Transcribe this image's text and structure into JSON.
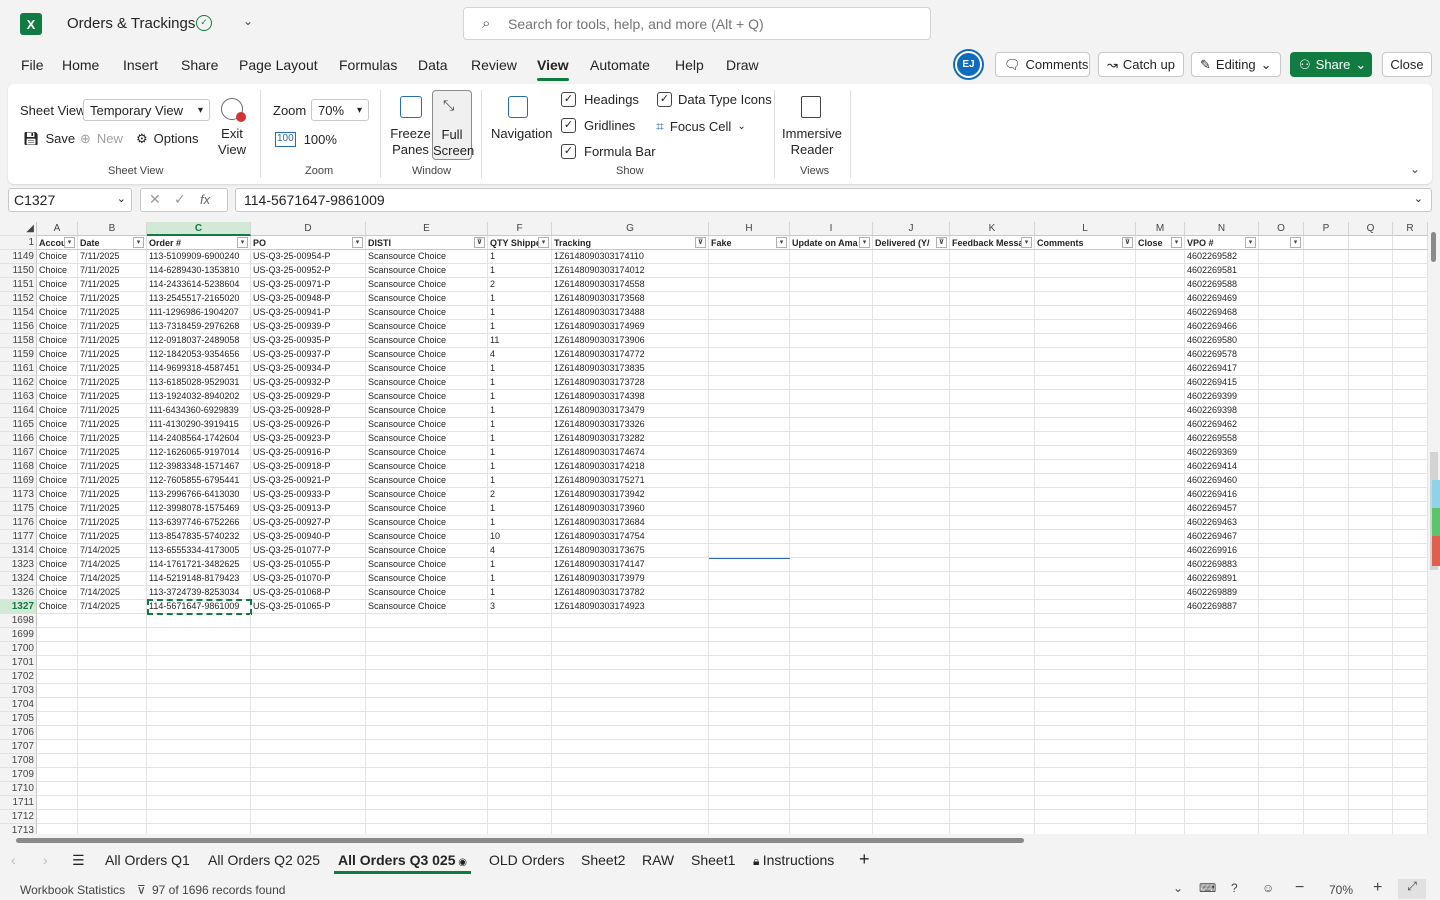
{
  "app": {
    "title": "Orders & Trackings",
    "search_placeholder": "Search for tools, help, and more (Alt + Q)"
  },
  "menu": [
    "File",
    "Home",
    "Insert",
    "Share",
    "Page Layout",
    "Formulas",
    "Data",
    "Review",
    "View",
    "Automate",
    "Help",
    "Draw"
  ],
  "active_menu": "View",
  "header_buttons": {
    "avatar": "EJ",
    "comments": "Comments",
    "catchup": "Catch up",
    "editing": "Editing",
    "share": "Share",
    "close": "Close"
  },
  "ribbon": {
    "sheet_view_label": "Sheet View",
    "sheet_view_value": "Temporary View",
    "save": "Save",
    "new": "New",
    "options": "Options",
    "exit_view": "Exit View",
    "sheet_view_group": "Sheet View",
    "zoom_label": "Zoom",
    "zoom_value": "70%",
    "zoom_100": "100%",
    "zoom_group": "Zoom",
    "freeze_panes": "Freeze Panes",
    "full_screen": "Full Screen",
    "window_group": "Window",
    "navigation": "Navigation",
    "headings": "Headings",
    "gridlines": "Gridlines",
    "formula_bar": "Formula Bar",
    "data_type_icons": "Data Type Icons",
    "focus_cell": "Focus Cell",
    "show_group": "Show",
    "immersive_reader": "Immersive Reader",
    "views_group": "Views"
  },
  "formula_bar": {
    "name_box": "C1327",
    "fx": "fx",
    "value": "114-5671647-9861009"
  },
  "columns": [
    "A",
    "B",
    "C",
    "D",
    "E",
    "F",
    "G",
    "H",
    "I",
    "J",
    "K",
    "L",
    "M",
    "N",
    "O",
    "P",
    "Q",
    "R"
  ],
  "selected_column": "C",
  "header_row": {
    "row_num": "1",
    "cells": [
      "Accou",
      "Date",
      "Order #",
      "PO",
      "DISTI",
      "QTY Shippe",
      "Tracking",
      "Fake",
      "Update on Ama",
      "Delivered (Y/",
      "Feedback Messa",
      "Comments",
      "Close",
      "VPO #",
      "",
      "",
      "",
      ""
    ]
  },
  "rows": [
    {
      "n": "1149",
      "a": "Choice",
      "b": "7/11/2025",
      "c": "113-5109909-6900240",
      "d": "US-Q3-25-00954-P",
      "e": "Scansource Choice",
      "f": "1",
      "g": "1Z6148090303174110",
      "n2": "4602269582"
    },
    {
      "n": "1150",
      "a": "Choice",
      "b": "7/11/2025",
      "c": "114-6289430-1353810",
      "d": "US-Q3-25-00952-P",
      "e": "Scansource Choice",
      "f": "1",
      "g": "1Z6148090303174012",
      "n2": "4602269581"
    },
    {
      "n": "1151",
      "a": "Choice",
      "b": "7/11/2025",
      "c": "114-2433614-5238604",
      "d": "US-Q3-25-00971-P",
      "e": "Scansource Choice",
      "f": "2",
      "g": "1Z6148090303174558",
      "n2": "4602269588"
    },
    {
      "n": "1152",
      "a": "Choice",
      "b": "7/11/2025",
      "c": "113-2545517-2165020",
      "d": "US-Q3-25-00948-P",
      "e": "Scansource Choice",
      "f": "1",
      "g": "1Z6148090303173568",
      "n2": "4602269469"
    },
    {
      "n": "1154",
      "a": "Choice",
      "b": "7/11/2025",
      "c": "111-1296986-1904207",
      "d": "US-Q3-25-00941-P",
      "e": "Scansource Choice",
      "f": "1",
      "g": "1Z6148090303173488",
      "n2": "4602269468"
    },
    {
      "n": "1156",
      "a": "Choice",
      "b": "7/11/2025",
      "c": "113-7318459-2976268",
      "d": "US-Q3-25-00939-P",
      "e": "Scansource Choice",
      "f": "1",
      "g": "1Z6148090303174969",
      "n2": "4602269466"
    },
    {
      "n": "1158",
      "a": "Choice",
      "b": "7/11/2025",
      "c": "112-0918037-2489058",
      "d": "US-Q3-25-00935-P",
      "e": "Scansource Choice",
      "f": "11",
      "g": "1Z6148090303173906",
      "n2": "4602269580"
    },
    {
      "n": "1159",
      "a": "Choice",
      "b": "7/11/2025",
      "c": "112-1842053-9354656",
      "d": "US-Q3-25-00937-P",
      "e": "Scansource Choice",
      "f": "4",
      "g": "1Z6148090303174772",
      "n2": "4602269578"
    },
    {
      "n": "1161",
      "a": "Choice",
      "b": "7/11/2025",
      "c": "114-9699318-4587451",
      "d": "US-Q3-25-00934-P",
      "e": "Scansource Choice",
      "f": "1",
      "g": "1Z6148090303173835",
      "n2": "4602269417"
    },
    {
      "n": "1162",
      "a": "Choice",
      "b": "7/11/2025",
      "c": "113-6185028-9529031",
      "d": "US-Q3-25-00932-P",
      "e": "Scansource Choice",
      "f": "1",
      "g": "1Z6148090303173728",
      "n2": "4602269415"
    },
    {
      "n": "1163",
      "a": "Choice",
      "b": "7/11/2025",
      "c": "113-1924032-8940202",
      "d": "US-Q3-25-00929-P",
      "e": "Scansource Choice",
      "f": "1",
      "g": "1Z6148090303174398",
      "n2": "4602269399"
    },
    {
      "n": "1164",
      "a": "Choice",
      "b": "7/11/2025",
      "c": "111-6434360-6929839",
      "d": "US-Q3-25-00928-P",
      "e": "Scansource Choice",
      "f": "1",
      "g": "1Z6148090303173479",
      "n2": "4602269398"
    },
    {
      "n": "1165",
      "a": "Choice",
      "b": "7/11/2025",
      "c": "111-4130290-3919415",
      "d": "US-Q3-25-00926-P",
      "e": "Scansource Choice",
      "f": "1",
      "g": "1Z6148090303173326",
      "n2": "4602269462"
    },
    {
      "n": "1166",
      "a": "Choice",
      "b": "7/11/2025",
      "c": "114-2408564-1742604",
      "d": "US-Q3-25-00923-P",
      "e": "Scansource Choice",
      "f": "1",
      "g": "1Z6148090303173282",
      "n2": "4602269558"
    },
    {
      "n": "1167",
      "a": "Choice",
      "b": "7/11/2025",
      "c": "112-1626065-9197014",
      "d": "US-Q3-25-00916-P",
      "e": "Scansource Choice",
      "f": "1",
      "g": "1Z6148090303174674",
      "n2": "4602269369"
    },
    {
      "n": "1168",
      "a": "Choice",
      "b": "7/11/2025",
      "c": "112-3983348-1571467",
      "d": "US-Q3-25-00918-P",
      "e": "Scansource Choice",
      "f": "1",
      "g": "1Z6148090303174218",
      "n2": "4602269414"
    },
    {
      "n": "1169",
      "a": "Choice",
      "b": "7/11/2025",
      "c": "112-7605855-6795441",
      "d": "US-Q3-25-00921-P",
      "e": "Scansource Choice",
      "f": "1",
      "g": "1Z6148090303175271",
      "n2": "4602269460"
    },
    {
      "n": "1173",
      "a": "Choice",
      "b": "7/11/2025",
      "c": "113-2996766-6413030",
      "d": "US-Q3-25-00933-P",
      "e": "Scansource Choice",
      "f": "2",
      "g": "1Z6148090303173942",
      "n2": "4602269416"
    },
    {
      "n": "1175",
      "a": "Choice",
      "b": "7/11/2025",
      "c": "112-3998078-1575469",
      "d": "US-Q3-25-00913-P",
      "e": "Scansource Choice",
      "f": "1",
      "g": "1Z6148090303173960",
      "n2": "4602269457"
    },
    {
      "n": "1176",
      "a": "Choice",
      "b": "7/11/2025",
      "c": "113-6397746-6752266",
      "d": "US-Q3-25-00927-P",
      "e": "Scansource Choice",
      "f": "1",
      "g": "1Z6148090303173684",
      "n2": "4602269463"
    },
    {
      "n": "1177",
      "a": "Choice",
      "b": "7/11/2025",
      "c": "113-8547835-5740232",
      "d": "US-Q3-25-00940-P",
      "e": "Scansource Choice",
      "f": "10",
      "g": "1Z6148090303174754",
      "n2": "4602269467"
    },
    {
      "n": "1314",
      "a": "Choice",
      "b": "7/14/2025",
      "c": "113-6555334-4173005",
      "d": "US-Q3-25-01077-P",
      "e": "Scansource Choice",
      "f": "4",
      "g": "1Z6148090303173675",
      "n2": "4602269916"
    },
    {
      "n": "1323",
      "a": "Choice",
      "b": "7/14/2025",
      "c": "114-1761721-3482625",
      "d": "US-Q3-25-01055-P",
      "e": "Scansource Choice",
      "f": "1",
      "g": "1Z6148090303174147",
      "n2": "4602269883"
    },
    {
      "n": "1324",
      "a": "Choice",
      "b": "7/14/2025",
      "c": "114-5219148-8179423",
      "d": "US-Q3-25-01070-P",
      "e": "Scansource Choice",
      "f": "1",
      "g": "1Z6148090303173979",
      "n2": "4602269891"
    },
    {
      "n": "1326",
      "a": "Choice",
      "b": "7/14/2025",
      "c": "113-3724739-8253034",
      "d": "US-Q3-25-01068-P",
      "e": "Scansource Choice",
      "f": "1",
      "g": "1Z6148090303173782",
      "n2": "4602269889"
    },
    {
      "n": "1327",
      "a": "Choice",
      "b": "7/14/2025",
      "c": "114-5671647-9861009",
      "d": "US-Q3-25-01065-P",
      "e": "Scansource Choice",
      "f": "3",
      "g": "1Z6148090303174923",
      "n2": "4602269887"
    }
  ],
  "empty_rows": [
    "1698",
    "1699",
    "1700",
    "1701",
    "1702",
    "1703",
    "1704",
    "1705",
    "1706",
    "1707",
    "1708",
    "1709",
    "1710",
    "1711",
    "1712",
    "1713"
  ],
  "sheets": [
    "All Orders Q1",
    "All Orders Q2 025",
    "All Orders Q3 025",
    "OLD Orders",
    "Sheet2",
    "RAW",
    "Sheet1",
    "Instructions"
  ],
  "active_sheet": "All Orders Q3 025",
  "status": {
    "workbook_stats": "Workbook Statistics",
    "records": "97 of 1696 records found",
    "zoom": "70%"
  },
  "colors": {
    "accent": "#107c41",
    "avatar": "#0f6cbd"
  }
}
